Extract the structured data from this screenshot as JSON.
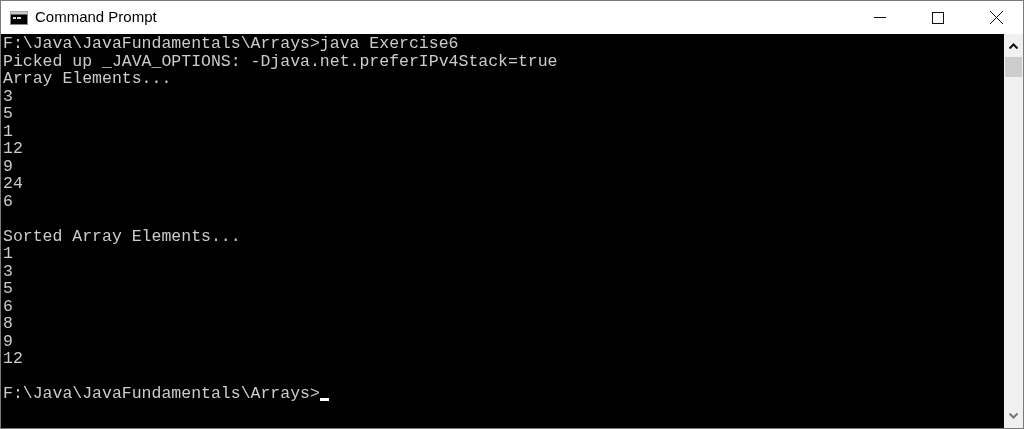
{
  "window": {
    "title": "Command Prompt"
  },
  "console": {
    "lines": [
      {
        "kind": "output",
        "text": "F:\\Java\\JavaFundamentals\\Arrays>java Exercise6"
      },
      {
        "kind": "output",
        "text": "Picked up _JAVA_OPTIONS: -Djava.net.preferIPv4Stack=true"
      },
      {
        "kind": "output",
        "text": "Array Elements..."
      },
      {
        "kind": "output",
        "text": "3"
      },
      {
        "kind": "output",
        "text": "5"
      },
      {
        "kind": "output",
        "text": "1"
      },
      {
        "kind": "output",
        "text": "12"
      },
      {
        "kind": "output",
        "text": "9"
      },
      {
        "kind": "output",
        "text": "24"
      },
      {
        "kind": "output",
        "text": "6"
      },
      {
        "kind": "blank"
      },
      {
        "kind": "output",
        "text": "Sorted Array Elements..."
      },
      {
        "kind": "output",
        "text": "1"
      },
      {
        "kind": "output",
        "text": "3"
      },
      {
        "kind": "output",
        "text": "5"
      },
      {
        "kind": "output",
        "text": "6"
      },
      {
        "kind": "output",
        "text": "8"
      },
      {
        "kind": "output",
        "text": "9"
      },
      {
        "kind": "output",
        "text": "12"
      },
      {
        "kind": "blank"
      },
      {
        "kind": "prompt",
        "text": "F:\\Java\\JavaFundamentals\\Arrays>",
        "cursor": true
      }
    ]
  }
}
